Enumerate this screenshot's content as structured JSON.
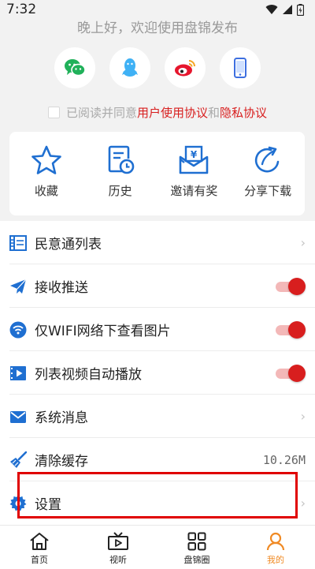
{
  "status": {
    "time": "7:32"
  },
  "greeting": "晚上好，欢迎使用盘锦发布",
  "login_options": [
    {
      "name": "wechat",
      "icon": "wechat-icon",
      "color": "#20b15a"
    },
    {
      "name": "qq",
      "icon": "qq-icon",
      "color": "#3fb1f5"
    },
    {
      "name": "weibo",
      "icon": "weibo-icon",
      "color": "#e6162d"
    },
    {
      "name": "phone",
      "icon": "phone-icon",
      "color": "#3d6fe0"
    }
  ],
  "agreement": {
    "prefix": "已阅读并同意",
    "user_agreement": "用户使用协议",
    "and": "和",
    "privacy_policy": "隐私协议"
  },
  "quick_actions": [
    {
      "label": "收藏",
      "icon": "star-icon"
    },
    {
      "label": "历史",
      "icon": "history-icon"
    },
    {
      "label": "邀请有奖",
      "icon": "invite-reward-icon"
    },
    {
      "label": "分享下载",
      "icon": "share-icon"
    }
  ],
  "menu": {
    "items": [
      {
        "label": "民意通列表",
        "icon": "film-list-icon",
        "trailing": "chevron"
      },
      {
        "label": "接收推送",
        "icon": "send-icon",
        "trailing": "toggle",
        "toggle_on": true
      },
      {
        "label": "仅WIFI网络下查看图片",
        "icon": "wifi-icon",
        "trailing": "toggle",
        "toggle_on": true
      },
      {
        "label": "列表视频自动播放",
        "icon": "video-icon",
        "trailing": "toggle",
        "toggle_on": true
      },
      {
        "label": "系统消息",
        "icon": "mail-icon",
        "trailing": "chevron"
      },
      {
        "label": "清除缓存",
        "icon": "broom-icon",
        "trailing": "value",
        "value": "10.26M"
      },
      {
        "label": "设置",
        "icon": "gear-icon",
        "trailing": "chevron"
      }
    ]
  },
  "tabs": [
    {
      "label": "首页",
      "icon": "home-icon",
      "active": false
    },
    {
      "label": "视听",
      "icon": "tv-icon",
      "active": false
    },
    {
      "label": "盘锦圈",
      "icon": "grid-icon",
      "active": false
    },
    {
      "label": "我的",
      "icon": "user-icon",
      "active": true
    }
  ],
  "colors": {
    "accent": "#d81e1e",
    "icon_blue": "#1f6fd1",
    "active_tab": "#f08a24"
  }
}
